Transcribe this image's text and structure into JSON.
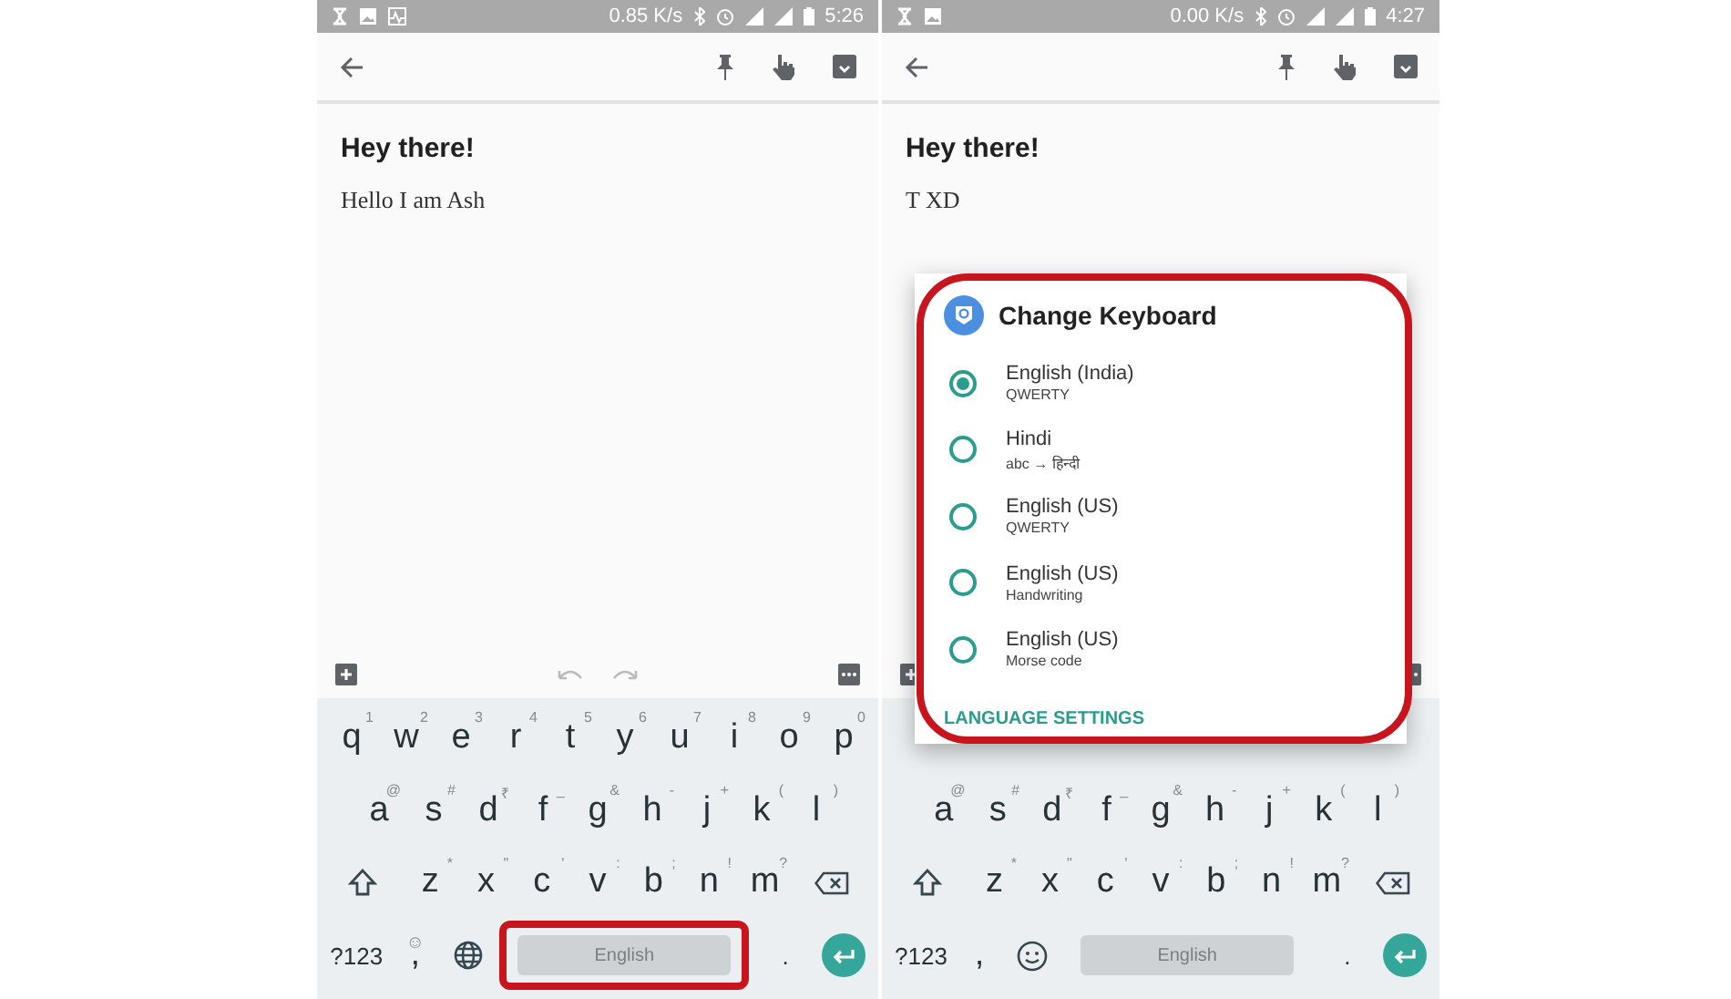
{
  "phones": [
    {
      "status_bar": {
        "notification_icons": [
          {
            "kind": "hourglass"
          },
          {
            "kind": "image"
          },
          {
            "kind": "pulse"
          }
        ],
        "speed": "0.85 K/s",
        "time": "5:26"
      },
      "note": {
        "title": "Hey there!",
        "body": "Hello I am Ash"
      },
      "strip_icons": [
        {
          "kind": "plus"
        },
        {
          "kind": "undo"
        },
        {
          "kind": "redo"
        },
        {
          "kind": "more"
        }
      ],
      "keyboard": {
        "row_1": [
          {
            "label": "q",
            "hint": "1"
          },
          {
            "label": "w",
            "hint": "2"
          },
          {
            "label": "e",
            "hint": "3"
          },
          {
            "label": "r",
            "hint": "4"
          },
          {
            "label": "t",
            "hint": "5"
          },
          {
            "label": "y",
            "hint": "6"
          },
          {
            "label": "u",
            "hint": "7"
          },
          {
            "label": "i",
            "hint": "8"
          },
          {
            "label": "o",
            "hint": "9"
          },
          {
            "label": "p",
            "hint": "0"
          }
        ],
        "row_2": [
          {
            "label": "a",
            "hint": "@"
          },
          {
            "label": "s",
            "hint": "#"
          },
          {
            "label": "d",
            "hint": "₹"
          },
          {
            "label": "f",
            "hint": "_"
          },
          {
            "label": "g",
            "hint": "&"
          },
          {
            "label": "h",
            "hint": "-"
          },
          {
            "label": "j",
            "hint": "+"
          },
          {
            "label": "k",
            "hint": "("
          },
          {
            "label": "l",
            "hint": ")"
          }
        ],
        "row_3": [
          {
            "label": "z",
            "hint": "*"
          },
          {
            "label": "x",
            "hint": "\""
          },
          {
            "label": "c",
            "hint": "'"
          },
          {
            "label": "v",
            "hint": ":"
          },
          {
            "label": "b",
            "hint": ";"
          },
          {
            "label": "n",
            "hint": "!"
          },
          {
            "label": "m",
            "hint": "?"
          }
        ],
        "bottom": [
          {
            "kind": "text",
            "label": "?123"
          },
          {
            "kind": "comma",
            "label": ",",
            "hint": "☺"
          },
          {
            "kind": "globe"
          },
          {
            "kind": "space",
            "label": "English",
            "highlighted": true
          },
          {
            "kind": "text",
            "label": "."
          },
          {
            "kind": "enter"
          }
        ]
      }
    },
    {
      "status_bar": {
        "notification_icons": [
          {
            "kind": "hourglass"
          },
          {
            "kind": "image"
          }
        ],
        "speed": "0.00 K/s",
        "time": "4:27"
      },
      "note": {
        "title": "Hey there!",
        "body": "T XD"
      },
      "strip_icons": [
        {
          "kind": "plus"
        },
        {
          "kind": "more"
        }
      ],
      "keyboard": {
        "row_2": [
          {
            "label": "a",
            "hint": "@"
          },
          {
            "label": "s",
            "hint": "#"
          },
          {
            "label": "d",
            "hint": "₹"
          },
          {
            "label": "f",
            "hint": "_"
          },
          {
            "label": "g",
            "hint": "&"
          },
          {
            "label": "h",
            "hint": "-"
          },
          {
            "label": "j",
            "hint": "+"
          },
          {
            "label": "k",
            "hint": "("
          },
          {
            "label": "l",
            "hint": ")"
          }
        ],
        "row_3": [
          {
            "label": "z",
            "hint": "*"
          },
          {
            "label": "x",
            "hint": "\""
          },
          {
            "label": "c",
            "hint": "'"
          },
          {
            "label": "v",
            "hint": ":"
          },
          {
            "label": "b",
            "hint": ";"
          },
          {
            "label": "n",
            "hint": "!"
          },
          {
            "label": "m",
            "hint": "?"
          }
        ],
        "bottom": [
          {
            "kind": "text",
            "label": "?123"
          },
          {
            "kind": "comma",
            "label": ","
          },
          {
            "kind": "emoji"
          },
          {
            "kind": "space",
            "label": "English",
            "highlighted": false
          },
          {
            "kind": "text",
            "label": "."
          },
          {
            "kind": "enter"
          }
        ]
      },
      "dialog": {
        "title": "Change Keyboard",
        "highlighted": true,
        "options": [
          {
            "label": "English (India)",
            "sub": "QWERTY",
            "selected": true
          },
          {
            "label": "Hindi",
            "sub": "abc → हिन्दी",
            "selected": false
          },
          {
            "label": "English (US)",
            "sub": "QWERTY",
            "selected": false
          },
          {
            "label": "English (US)",
            "sub": "Handwriting",
            "selected": false
          },
          {
            "label": "English (US)",
            "sub": "Morse code",
            "selected": false
          }
        ],
        "link": "LANGUAGE SETTINGS"
      }
    }
  ]
}
